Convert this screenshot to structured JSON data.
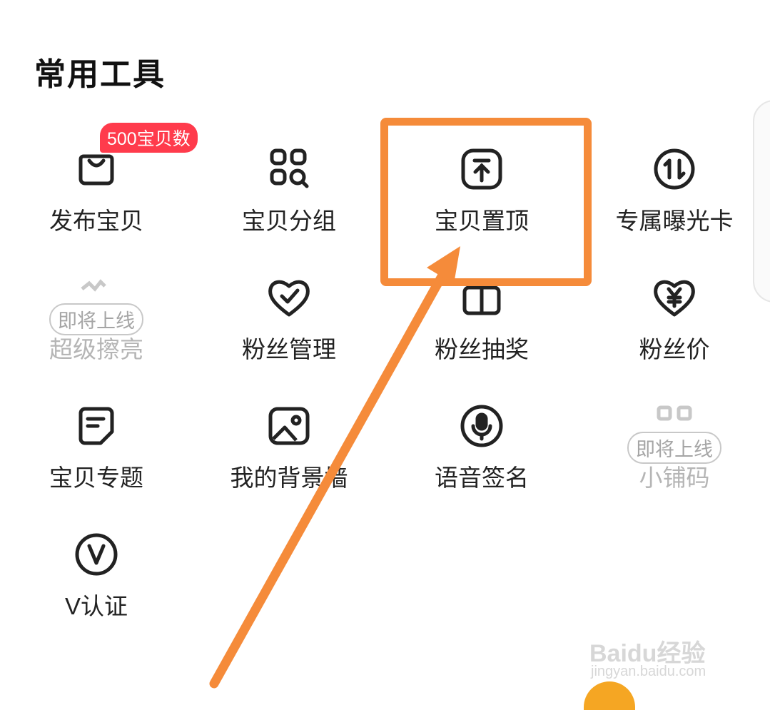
{
  "section_title": "常用工具",
  "badge_text": "500宝贝数",
  "coming_soon": "即将上线",
  "tools": {
    "publish": "发布宝贝",
    "group": "宝贝分组",
    "pin": "宝贝置顶",
    "exposure_card": "专属曝光卡",
    "super_polish": "超级擦亮",
    "fan_manage": "粉丝管理",
    "fan_lottery": "粉丝抽奖",
    "fan_price": "粉丝价",
    "topic": "宝贝专题",
    "background_wall": "我的背景墙",
    "voice_signature": "语音签名",
    "shop_code": "小铺码",
    "v_verify": "V认证"
  },
  "watermark": {
    "brand": "Baidu经验",
    "url": "jingyan.baidu.com"
  },
  "colors": {
    "highlight": "#f58b3a",
    "badge": "#ff3b4c",
    "icon": "#222222",
    "disabled": "#b5b5b5"
  }
}
